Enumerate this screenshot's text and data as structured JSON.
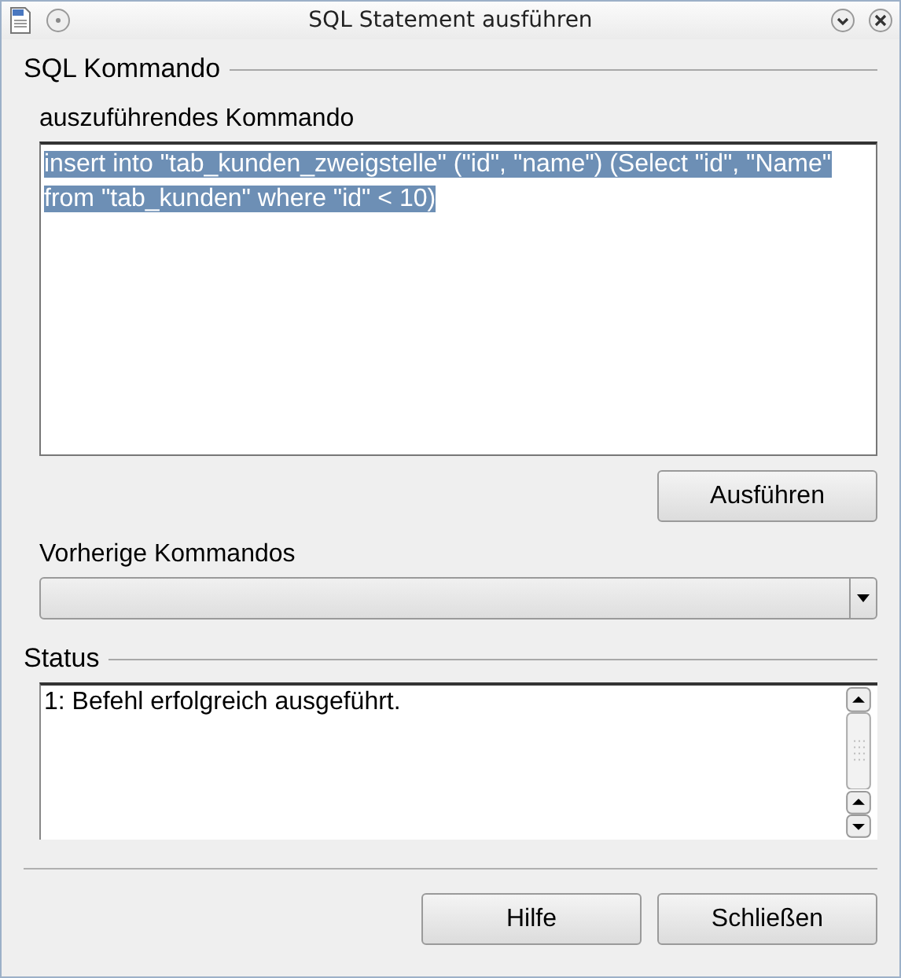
{
  "window": {
    "title": "SQL Statement ausführen"
  },
  "sql_section": {
    "title": "SQL Kommando",
    "command_label": "auszuführendes Kommando",
    "command": {
      "text": "insert into \"tab_kunden_zweigstelle\" (\"id\", \"name\") (Select \"id\", \"Name\" from \"tab_kunden\" where \"id\" < 10)",
      "selected": true
    },
    "execute_button": "Ausführen",
    "history_label": "Vorherige Kommandos"
  },
  "status_section": {
    "title": "Status",
    "text": "1: Befehl erfolgreich ausgeführt."
  },
  "buttons": [
    "Hilfe",
    "Schließen"
  ]
}
